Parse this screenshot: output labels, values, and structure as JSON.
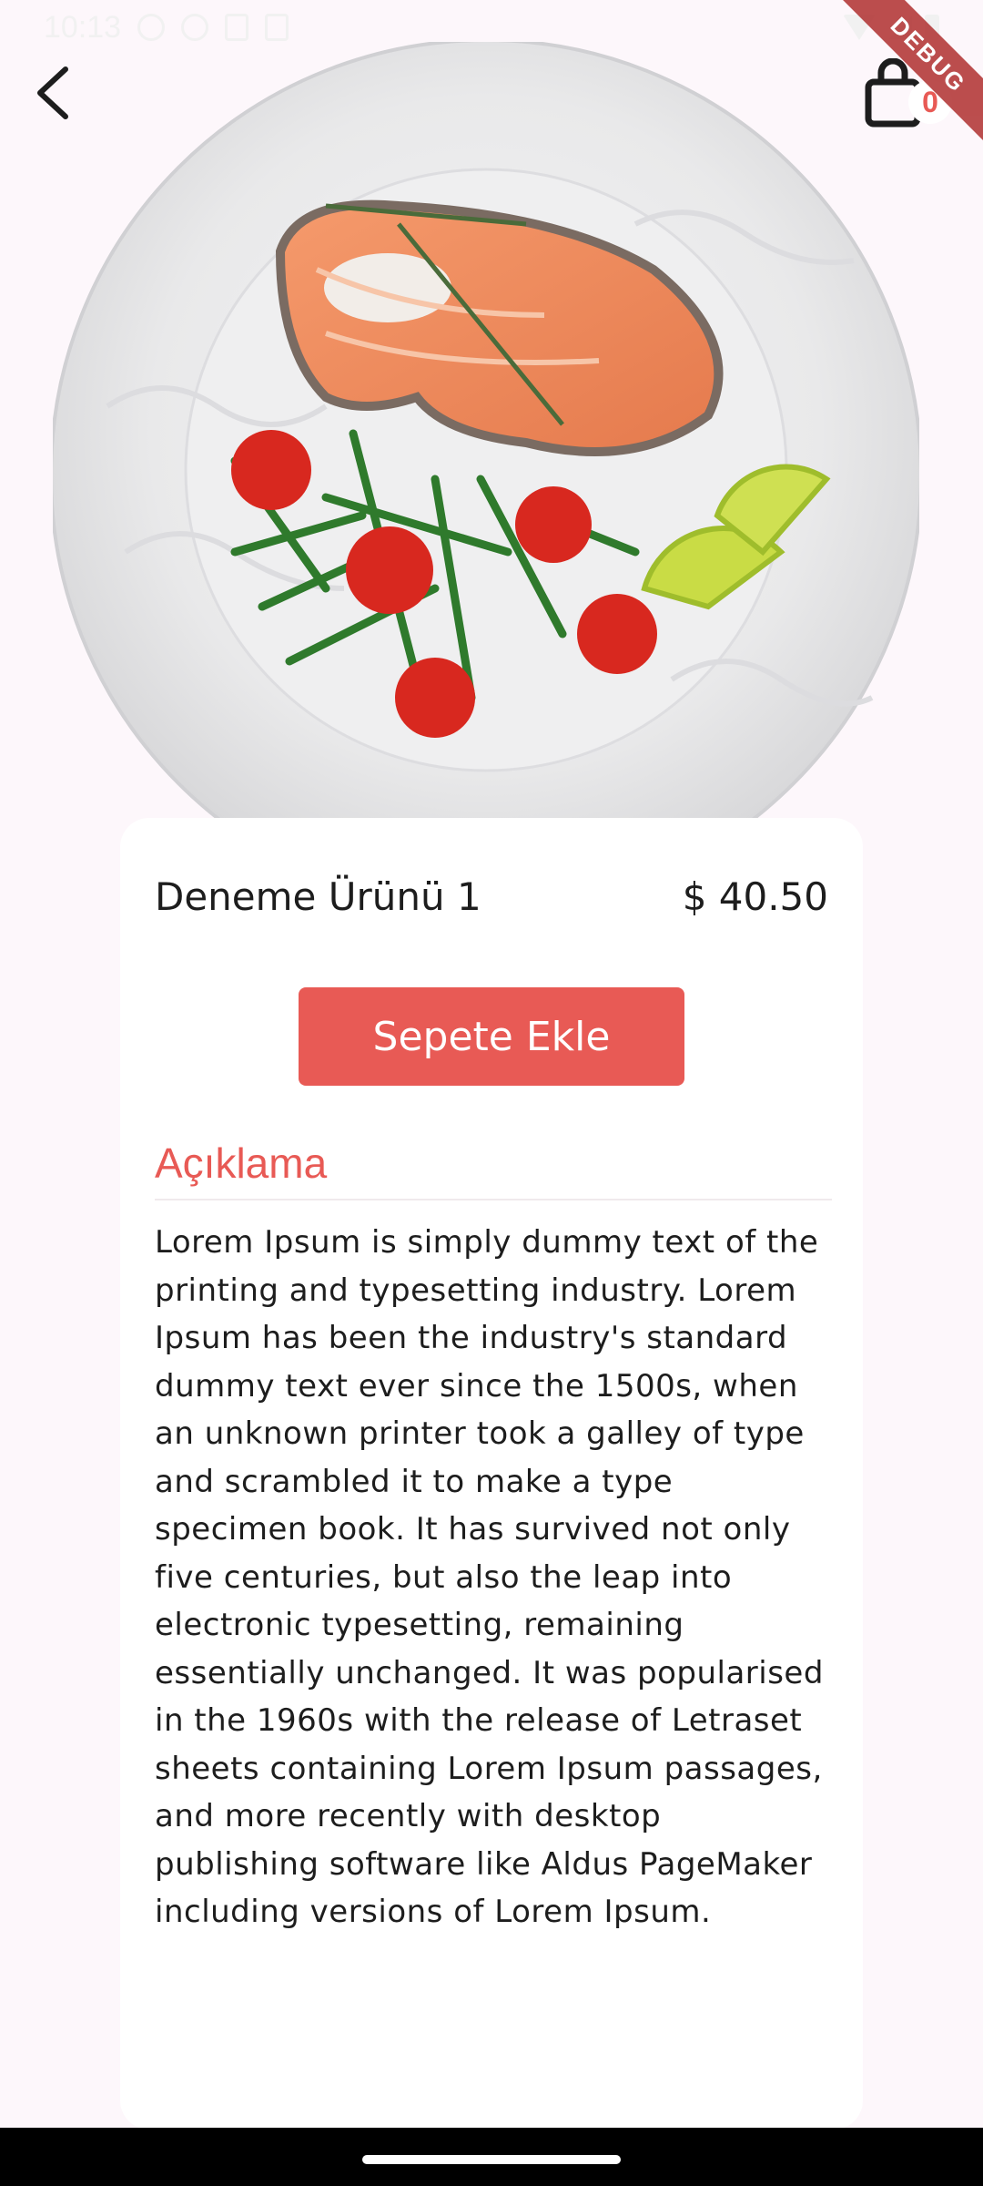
{
  "status_bar": {
    "time": "10:13"
  },
  "header": {
    "back_icon": "chevron-left-icon",
    "cart_icon": "shopping-bag-icon",
    "cart_count": "0",
    "debug_banner": "DEBUG"
  },
  "product": {
    "image_icon": "salmon-plate-photo",
    "name": "Deneme Ürünü 1",
    "price": "$ 40.50",
    "add_to_cart_label": "Sepete Ekle",
    "description_title": "Açıklama",
    "description": "Lorem Ipsum is simply dummy text of the printing and typesetting industry. Lorem Ipsum has been the industry's standard dummy text ever since the 1500s, when an unknown printer took a galley of type and scrambled it to make a type specimen book. It has survived not only five centuries, but also the leap into electronic typesetting, remaining essentially unchanged. It was popularised in the 1960s with the release of Letraset sheets containing Lorem Ipsum passages, and more recently with desktop publishing software like Aldus PageMaker including versions of Lorem Ipsum."
  },
  "colors": {
    "accent": "#e85a55",
    "background": "#fdf7fb",
    "card": "#ffffff",
    "text": "#1d1d1d"
  }
}
